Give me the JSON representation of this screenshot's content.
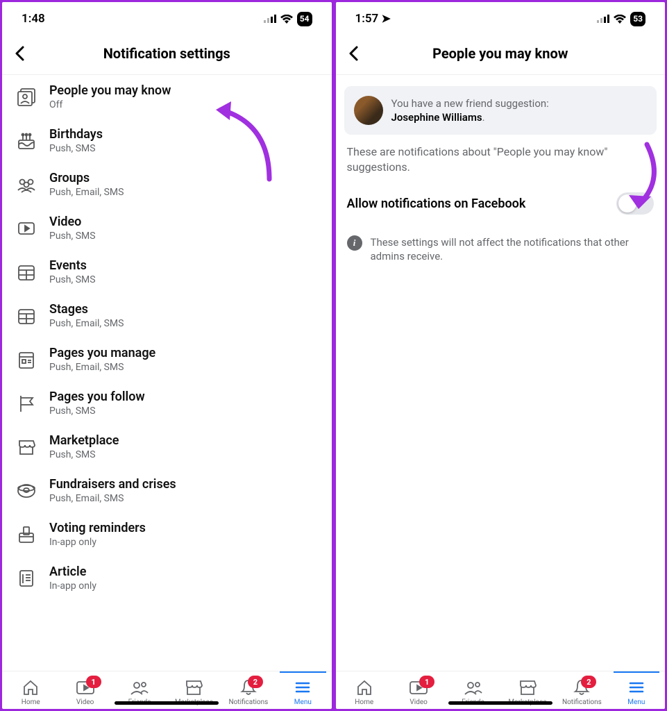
{
  "left": {
    "statusbar": {
      "time": "1:48",
      "battery": "54"
    },
    "header": {
      "title": "Notification settings"
    },
    "settings": [
      {
        "icon": "people-card",
        "label": "People you may know",
        "sub": "Off"
      },
      {
        "icon": "birthday",
        "label": "Birthdays",
        "sub": "Push, SMS"
      },
      {
        "icon": "groups",
        "label": "Groups",
        "sub": "Push, Email, SMS"
      },
      {
        "icon": "video",
        "label": "Video",
        "sub": "Push, SMS"
      },
      {
        "icon": "events",
        "label": "Events",
        "sub": "Push, SMS"
      },
      {
        "icon": "stages",
        "label": "Stages",
        "sub": "Push, Email, SMS"
      },
      {
        "icon": "pages-manage",
        "label": "Pages you manage",
        "sub": "Push, Email, SMS"
      },
      {
        "icon": "pages-follow",
        "label": "Pages you follow",
        "sub": "Push, SMS"
      },
      {
        "icon": "marketplace",
        "label": "Marketplace",
        "sub": "Push, SMS"
      },
      {
        "icon": "fundraisers",
        "label": "Fundraisers and crises",
        "sub": "Push, Email, SMS"
      },
      {
        "icon": "voting",
        "label": "Voting reminders",
        "sub": "In-app only"
      },
      {
        "icon": "article",
        "label": "Article",
        "sub": "In-app only"
      }
    ]
  },
  "right": {
    "statusbar": {
      "time": "1:57",
      "battery": "53"
    },
    "header": {
      "title": "People you may know"
    },
    "suggestion": {
      "prefix": "You have a new friend suggestion:",
      "name": "Josephine Williams"
    },
    "description": "These are notifications about \"People you may know\" suggestions.",
    "toggle": {
      "label": "Allow notifications on Facebook",
      "on": false
    },
    "info": "These settings will not affect the notifications that other admins receive."
  },
  "nav": {
    "items": [
      {
        "key": "home",
        "label": "Home"
      },
      {
        "key": "video",
        "label": "Video",
        "badge": "1"
      },
      {
        "key": "friends",
        "label": "Friends"
      },
      {
        "key": "marketplace",
        "label": "Marketplace"
      },
      {
        "key": "notifications",
        "label": "Notifications",
        "badge": "2"
      },
      {
        "key": "menu",
        "label": "Menu",
        "active": true
      }
    ]
  }
}
